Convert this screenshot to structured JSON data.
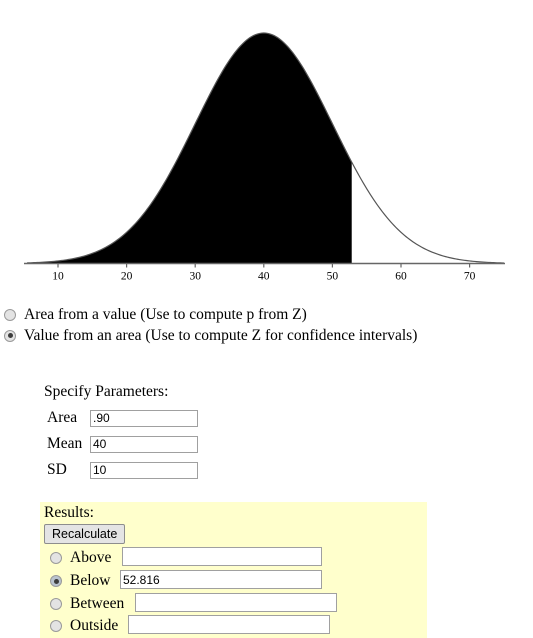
{
  "chart_data": {
    "type": "area",
    "title": "",
    "xlabel": "",
    "ylabel": "",
    "distribution": "normal",
    "mean": 40,
    "sd": 10,
    "xlim": [
      5.5,
      75
    ],
    "xticks": [
      10,
      20,
      30,
      40,
      50,
      60,
      70
    ],
    "xtick_labels": [
      "10",
      "20",
      "30",
      "40",
      "50",
      "60",
      "70"
    ],
    "grid": false,
    "legend": null,
    "shaded_region": {
      "label": "Below",
      "from": "-infinity",
      "to": 52.816,
      "area": 0.9,
      "fill_color": "#000000"
    },
    "curve_color": "#555555",
    "axis_color": "#666666"
  },
  "mode_options": [
    {
      "id": "area-from-value",
      "label": "Area from a value (Use to compute p from Z)",
      "selected": false
    },
    {
      "id": "value-from-area",
      "label": "Value from an area (Use to compute Z for confidence intervals)",
      "selected": true
    }
  ],
  "parameters": {
    "title": "Specify Parameters:",
    "fields": [
      {
        "label": "Area",
        "value": ".90",
        "placeholder": ""
      },
      {
        "label": "Mean",
        "value": "40",
        "placeholder": ""
      },
      {
        "label": "SD",
        "value": "10",
        "placeholder": ""
      }
    ]
  },
  "results": {
    "title": "Results:",
    "recalculate_label": "Recalculate",
    "options": [
      {
        "label": "Above",
        "value": "",
        "selected": false
      },
      {
        "label": "Below",
        "value": "52.816",
        "selected": true
      },
      {
        "label": "Between",
        "value": "",
        "selected": false
      },
      {
        "label": "Outside",
        "value": "",
        "selected": false
      }
    ]
  },
  "colors": {
    "results_panel_bg": "#ffffcc",
    "curve_fill": "#000000",
    "curve_stroke": "#555555",
    "radio_selected_bg": "#b9c3cf",
    "button_bg": "#e4e4e4"
  }
}
